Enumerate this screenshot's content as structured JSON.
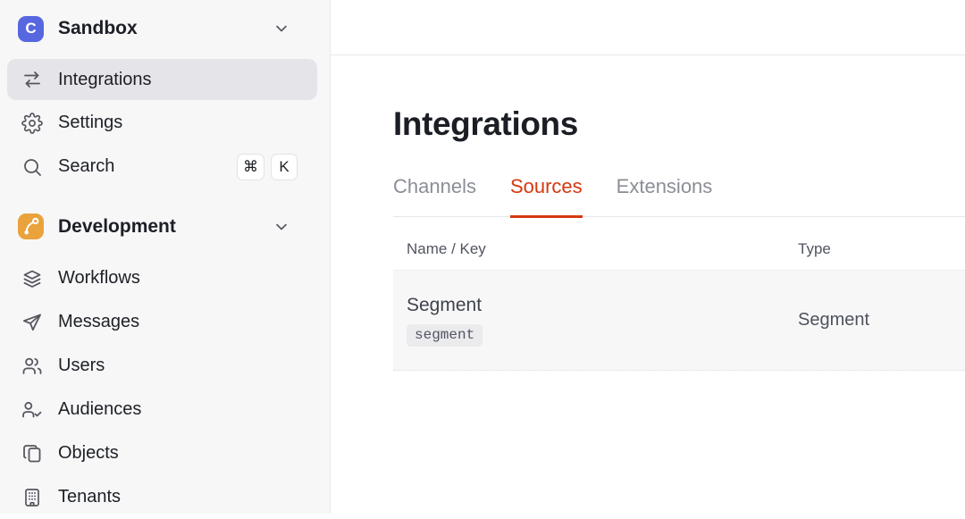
{
  "sidebar": {
    "workspace": {
      "name": "Sandbox",
      "logo_letter": "C"
    },
    "items": [
      {
        "label": "Integrations"
      },
      {
        "label": "Settings"
      },
      {
        "label": "Search"
      }
    ],
    "search_shortcut": {
      "mod": "⌘",
      "key": "K"
    },
    "development": {
      "label": "Development"
    },
    "dev_items": [
      {
        "label": "Workflows"
      },
      {
        "label": "Messages"
      },
      {
        "label": "Users"
      },
      {
        "label": "Audiences"
      },
      {
        "label": "Objects"
      },
      {
        "label": "Tenants"
      }
    ]
  },
  "main": {
    "title": "Integrations",
    "tabs": [
      {
        "label": "Channels"
      },
      {
        "label": "Sources"
      },
      {
        "label": "Extensions"
      }
    ],
    "active_tab": "Sources",
    "table": {
      "headers": {
        "name_key": "Name / Key",
        "type": "Type"
      },
      "rows": [
        {
          "name": "Segment",
          "key": "segment",
          "type": "Segment"
        }
      ]
    }
  },
  "colors": {
    "accent_red": "#d6380f",
    "brand_indigo": "#5767e0",
    "development_orange": "#e9a23c",
    "sidebar_bg": "#f7f7f8",
    "active_item_bg": "#e5e4e9"
  }
}
